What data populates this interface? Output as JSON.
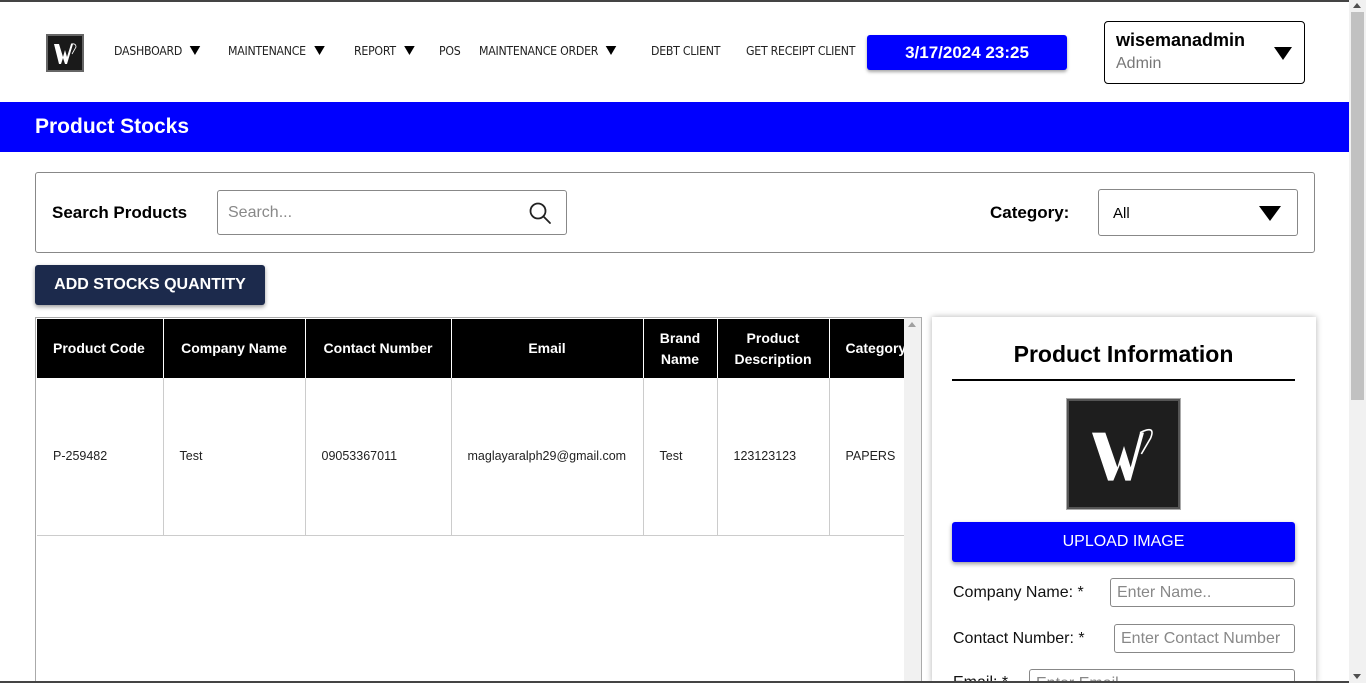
{
  "header": {
    "nav": [
      {
        "label": "DASHBOARD",
        "has_dropdown": true
      },
      {
        "label": "MAINTENANCE",
        "has_dropdown": true
      },
      {
        "label": "REPORT",
        "has_dropdown": true
      },
      {
        "label": "POS",
        "has_dropdown": false
      },
      {
        "label": "MAINTENANCE ORDER",
        "has_dropdown": true
      },
      {
        "label": "DEBT CLIENT",
        "has_dropdown": false
      },
      {
        "label": "GET RECEIPT CLIENT",
        "has_dropdown": false
      }
    ],
    "datetime": "3/17/2024 23:25",
    "user": {
      "name": "wisemanadmin",
      "role": "Admin"
    }
  },
  "page": {
    "title": "Product Stocks"
  },
  "search": {
    "label": "Search Products",
    "placeholder": "Search...",
    "category_label": "Category:",
    "category_value": "All"
  },
  "actions": {
    "add_stocks_label": "ADD STOCKS QUANTITY"
  },
  "table": {
    "columns": [
      "Product Code",
      "Company Name",
      "Contact Number",
      "Email",
      "Brand Name",
      "Product Description",
      "Category"
    ],
    "rows": [
      [
        "P-259482",
        "Test",
        "09053367011",
        "maglayaralph29@gmail.com",
        "Test",
        "123123123",
        "PAPERS"
      ]
    ]
  },
  "info": {
    "title": "Product Information",
    "upload_label": "UPLOAD IMAGE",
    "company_name_label": "Company Name: *",
    "company_name_placeholder": "Enter Name..",
    "contact_number_label": "Contact Number: *",
    "contact_number_placeholder": "Enter Contact Number",
    "email_label": "Email: *",
    "email_placeholder": "Enter Email.."
  },
  "colors": {
    "accent": "#0000ff",
    "dark_button": "#1c2a4c",
    "table_header": "#000000"
  },
  "icons": {
    "search": "search-icon",
    "dropdown": "chevron-down-icon"
  }
}
